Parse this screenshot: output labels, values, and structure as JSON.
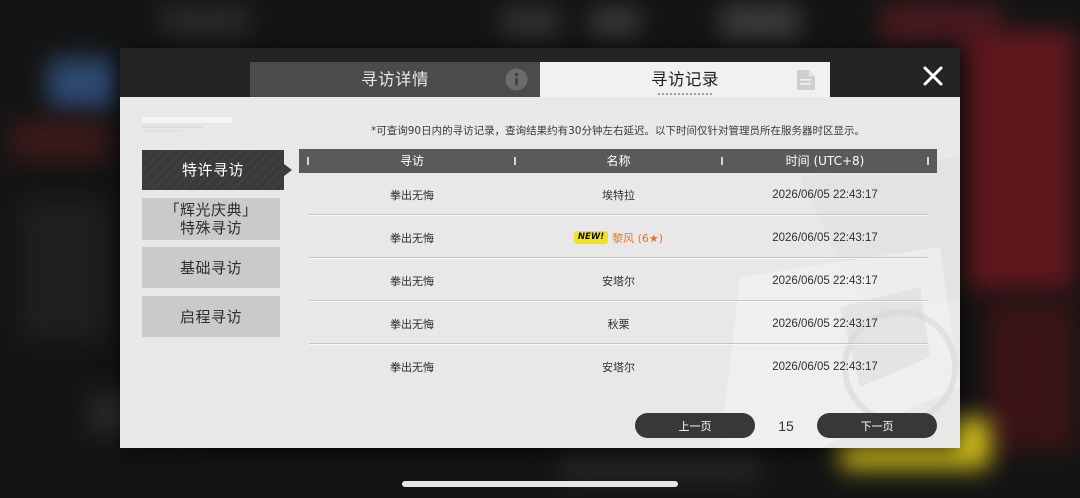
{
  "tabs": {
    "details": {
      "label": "寻访详情",
      "icon": "info-icon",
      "active": false
    },
    "records": {
      "label": "寻访记录",
      "icon": "document-icon",
      "active": true
    }
  },
  "close": {
    "icon": "close-icon"
  },
  "sidebar": {
    "items": [
      {
        "label": "特许寻访",
        "active": true
      },
      {
        "label": "「辉光庆典」\n特殊寻访",
        "active": false
      },
      {
        "label": "基础寻访",
        "active": false
      },
      {
        "label": "启程寻访",
        "active": false
      }
    ]
  },
  "notice": "*可查询90日内的寻访记录，查询结果约有30分钟左右延迟。以下时间仅针对管理员所在服务器时区显示。",
  "table": {
    "headers": [
      "寻访",
      "名称",
      "时间 (UTC+8)"
    ],
    "rows": [
      {
        "banner": "拳出无悔",
        "name": "埃特拉",
        "time": "2026/06/05 22:43:17"
      },
      {
        "banner": "拳出无悔",
        "name": "黎风 (6★)",
        "time": "2026/06/05 22:43:17",
        "badge": "NEW!",
        "highlight": true
      },
      {
        "banner": "拳出无悔",
        "name": "安塔尔",
        "time": "2026/06/05 22:43:17"
      },
      {
        "banner": "拳出无悔",
        "name": "秋栗",
        "time": "2026/06/05 22:43:17"
      },
      {
        "banner": "拳出无悔",
        "name": "安塔尔",
        "time": "2026/06/05 22:43:17"
      }
    ]
  },
  "pagination": {
    "prev_label": "上一页",
    "page": "15",
    "next_label": "下一页"
  },
  "colors": {
    "accent_name": "#f0731c",
    "new_badge": "#f2e21f"
  }
}
